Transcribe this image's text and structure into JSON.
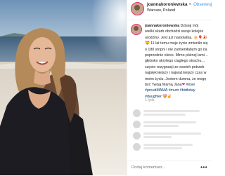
{
  "post": {
    "username": "joannakoroniewska",
    "separator": "•",
    "follow_label": "Obserwuj",
    "location": "Warsaw, Poland",
    "caption_lines": [
      {
        "user": "joannakoroniewska",
        "text": " Dzisiaj mój"
      },
      {
        "text": "wielki skarb obchodzi swoje kolejne"
      },
      {
        "text": "urodziny. Jest już nastolatką. 🎂🎈🎉"
      },
      {
        "text": "💝 11 lat temu moje życie zmieniło się"
      },
      {
        "text": "o 180 stopni i nie zamieniłabym go na"
      },
      {
        "text": "poprzednie okres. Mimo późnej lami…"
      },
      {
        "text": "głęboko ukrytego ciągłego strachu…"
      },
      {
        "text": "często rezygnacji ze swoich potrzeb"
      },
      {
        "text": "najpiękniejszy i najważniejszy czas w"
      },
      {
        "text": "moim życiu. Jestem dumna, że mogę"
      },
      {
        "text": "być Twoją Mamą Jana",
        "heart": "❤",
        "after": " #love"
      },
      {
        "tags": "#proudMAMA #mum #birthday"
      },
      {
        "tags": "#daughter",
        "after": " 💝✌"
      }
    ],
    "time_ago": "1 tydz.",
    "add_comment_placeholder": "Dodaj komentarz...",
    "more_glyph": "•••"
  },
  "colors": {
    "accent": "#3897f0",
    "ring": "#e1306c",
    "heart": "#e0245e",
    "hashtag": "#003569"
  },
  "icons": {
    "avatar": "profile-photo",
    "more": "ellipsis-icon"
  }
}
